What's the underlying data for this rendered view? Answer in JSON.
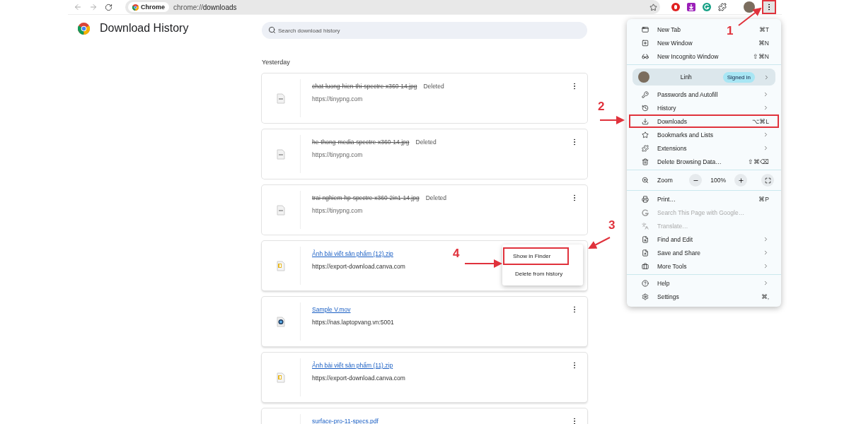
{
  "toolbar": {
    "site_chip": "Chrome",
    "url": "chrome://**downloads**",
    "menu_button_highlighted": true
  },
  "page": {
    "title": "Download History",
    "search": {
      "placeholder": "Search download history"
    },
    "section": "Yesterday",
    "downloads": [
      {
        "kind": "image",
        "name": "chat-luong-hien-thi-spectre-x360-14.jpg",
        "status": "Deleted",
        "source": "https://tinypng.com",
        "deleted": true
      },
      {
        "kind": "image",
        "name": "he-thong-media-spectre-x360-14.jpg",
        "status": "Deleted",
        "source": "https://tinypng.com",
        "deleted": true
      },
      {
        "kind": "image",
        "name": "trai-nghiem-hp-spectre-x360-2in1-14.jpg",
        "status": "Deleted",
        "source": "https://tinypng.com",
        "deleted": true
      },
      {
        "kind": "zip",
        "name": "Ảnh bài viết sản phẩm (12).zip",
        "source": "https://export-download.canva.com",
        "deleted": false
      },
      {
        "kind": "video",
        "name": "Sample V.mov",
        "source": "https://nas.laptopvang.vn:5001",
        "deleted": false
      },
      {
        "kind": "zip",
        "name": "Ảnh bài viết sản phẩm (11).zip",
        "source": "https://export-download.canva.com",
        "deleted": false
      },
      {
        "kind": "pdf",
        "name": "surface-pro-11-specs.pdf",
        "deleted": false
      }
    ],
    "context_menu": {
      "items": [
        {
          "label": "Show in Finder",
          "highlighted": true
        },
        {
          "label": "Delete from history",
          "highlighted": false
        }
      ]
    }
  },
  "menu": {
    "sections": [
      [
        {
          "kind": "item",
          "label": "New Tab",
          "shortcut": "⌘T",
          "submenu": false,
          "disabled": false,
          "highlighted": false
        },
        {
          "kind": "item",
          "label": "New Window",
          "shortcut": "⌘N",
          "submenu": false,
          "disabled": false,
          "highlighted": false
        },
        {
          "kind": "item",
          "label": "New Incognito Window",
          "shortcut": "⇧⌘N",
          "submenu": false,
          "disabled": false,
          "highlighted": false
        }
      ],
      [
        {
          "kind": "profile",
          "label": "Linh",
          "badge": "Signed in",
          "submenu": true,
          "highlighted": false
        },
        {
          "kind": "item",
          "label": "Passwords and Autofill",
          "submenu": true,
          "disabled": false,
          "highlighted": false
        },
        {
          "kind": "item",
          "label": "History",
          "submenu": true,
          "disabled": false,
          "highlighted": false
        },
        {
          "kind": "item",
          "label": "Downloads",
          "shortcut": "⌥⌘L",
          "submenu": false,
          "disabled": false,
          "highlighted": true
        },
        {
          "kind": "item",
          "label": "Bookmarks and Lists",
          "submenu": true,
          "disabled": false,
          "highlighted": false
        },
        {
          "kind": "item",
          "label": "Extensions",
          "submenu": true,
          "disabled": false,
          "highlighted": false
        },
        {
          "kind": "item",
          "label": "Delete Browsing Data…",
          "shortcut": "⇧⌘⌫",
          "submenu": false,
          "disabled": false,
          "highlighted": false
        }
      ],
      [
        {
          "kind": "zoom",
          "label": "Zoom",
          "value": "100%"
        }
      ],
      [
        {
          "kind": "item",
          "label": "Print…",
          "shortcut": "⌘P",
          "submenu": false,
          "disabled": false,
          "highlighted": false
        },
        {
          "kind": "item",
          "label": "Search This Page with Google…",
          "submenu": false,
          "disabled": true,
          "highlighted": false
        },
        {
          "kind": "item",
          "label": "Translate…",
          "submenu": false,
          "disabled": true,
          "highlighted": false
        },
        {
          "kind": "item",
          "label": "Find and Edit",
          "submenu": true,
          "disabled": false,
          "highlighted": false
        },
        {
          "kind": "item",
          "label": "Save and Share",
          "submenu": true,
          "disabled": false,
          "highlighted": false
        },
        {
          "kind": "item",
          "label": "More Tools",
          "submenu": true,
          "disabled": false,
          "highlighted": false
        }
      ],
      [
        {
          "kind": "item",
          "label": "Help",
          "submenu": true,
          "disabled": false,
          "highlighted": false
        },
        {
          "kind": "item",
          "label": "Settings",
          "shortcut": "⌘,",
          "submenu": false,
          "disabled": false,
          "highlighted": false
        }
      ]
    ]
  },
  "annotations": [
    {
      "label": "1"
    },
    {
      "label": "2"
    },
    {
      "label": "3"
    },
    {
      "label": "4"
    }
  ]
}
